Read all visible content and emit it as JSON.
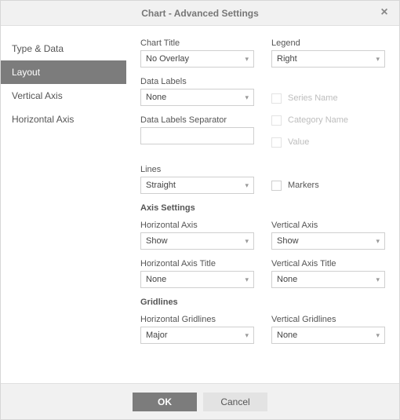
{
  "dialog": {
    "title": "Chart - Advanced Settings"
  },
  "sidebar": {
    "items": [
      {
        "label": "Type & Data",
        "active": false
      },
      {
        "label": "Layout",
        "active": true
      },
      {
        "label": "Vertical Axis",
        "active": false
      },
      {
        "label": "Horizontal Axis",
        "active": false
      }
    ]
  },
  "form": {
    "chart_title": {
      "label": "Chart Title",
      "value": "No Overlay"
    },
    "legend": {
      "label": "Legend",
      "value": "Right"
    },
    "data_labels": {
      "label": "Data Labels",
      "value": "None"
    },
    "series_name": {
      "label": "Series Name"
    },
    "category_name": {
      "label": "Category Name"
    },
    "value_cb": {
      "label": "Value"
    },
    "separator": {
      "label": "Data Labels Separator",
      "value": ""
    },
    "lines": {
      "label": "Lines",
      "value": "Straight"
    },
    "markers": {
      "label": "Markers"
    },
    "axis_section": "Axis Settings",
    "h_axis": {
      "label": "Horizontal Axis",
      "value": "Show"
    },
    "v_axis": {
      "label": "Vertical Axis",
      "value": "Show"
    },
    "h_axis_title": {
      "label": "Horizontal Axis Title",
      "value": "None"
    },
    "v_axis_title": {
      "label": "Vertical Axis Title",
      "value": "None"
    },
    "grid_section": "Gridlines",
    "h_grid": {
      "label": "Horizontal Gridlines",
      "value": "Major"
    },
    "v_grid": {
      "label": "Vertical Gridlines",
      "value": "None"
    }
  },
  "footer": {
    "ok": "OK",
    "cancel": "Cancel"
  }
}
